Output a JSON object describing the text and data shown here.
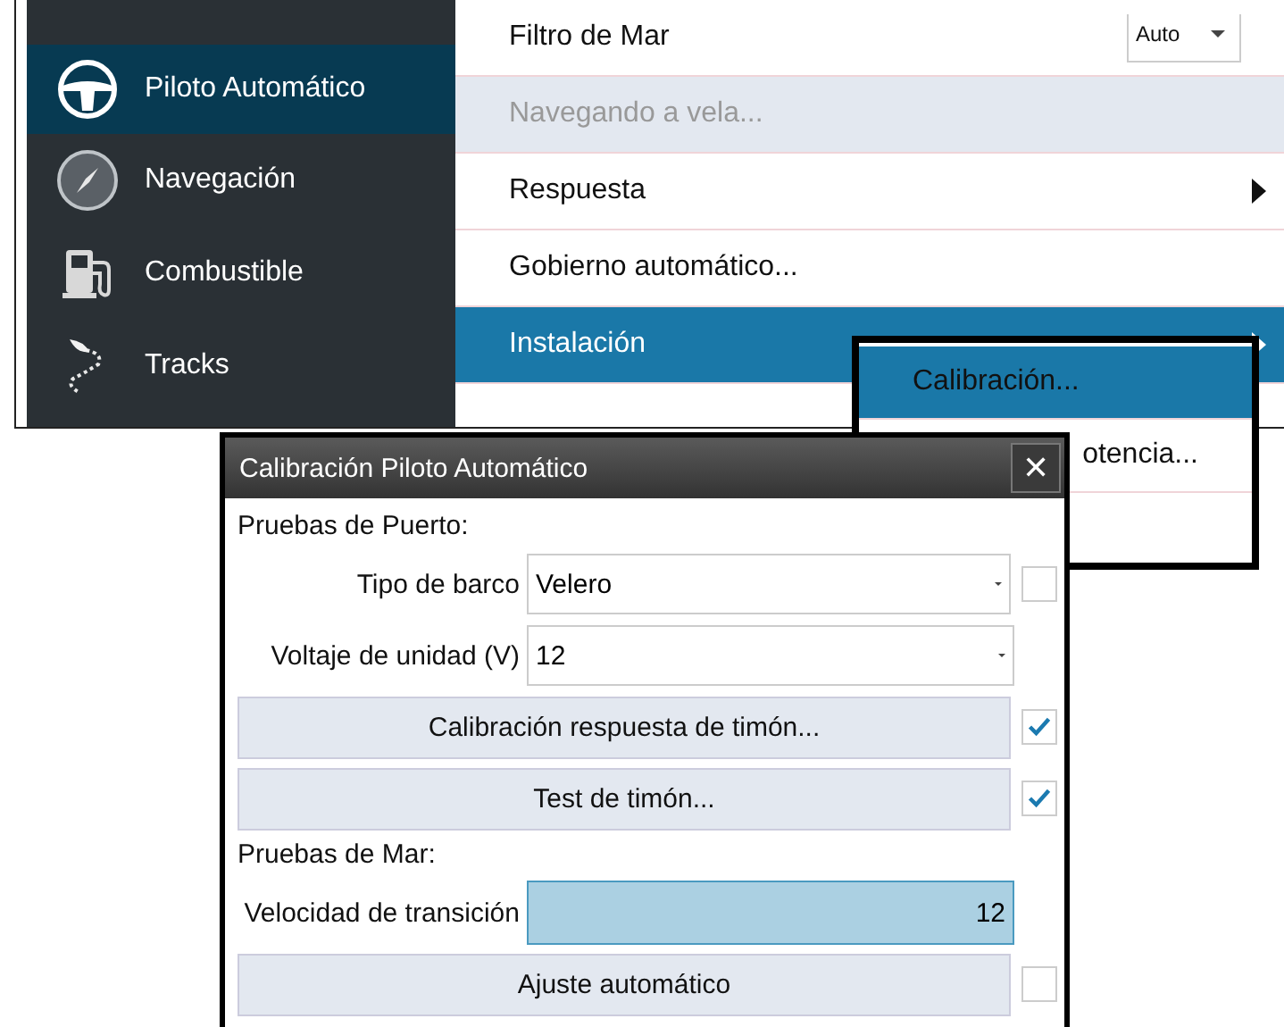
{
  "sidebar": {
    "items": [
      {
        "label": "Piloto Automático",
        "selected": true
      },
      {
        "label": "Navegación",
        "selected": false
      },
      {
        "label": "Combustible",
        "selected": false
      },
      {
        "label": "Tracks",
        "selected": false
      }
    ]
  },
  "menu": {
    "items": [
      {
        "kind": "dropdown",
        "label": "Filtro de Mar",
        "value": "Auto",
        "selected": false,
        "disabled": false
      },
      {
        "kind": "action",
        "label": "Navegando a vela...",
        "selected": false,
        "disabled": true
      },
      {
        "kind": "submenu",
        "label": "Respuesta",
        "selected": false,
        "disabled": false
      },
      {
        "kind": "action",
        "label": "Gobierno automático...",
        "selected": false,
        "disabled": false
      },
      {
        "kind": "submenu",
        "label": "Instalación",
        "selected": true,
        "disabled": false
      }
    ]
  },
  "submenu": {
    "items": [
      {
        "label": "Calibración...",
        "selected": true
      },
      {
        "label": "otencia...",
        "selected": false
      }
    ]
  },
  "dialog": {
    "title": "Calibración Piloto Automático",
    "close": "✕",
    "rows": [
      {
        "kind": "heading",
        "text": "Pruebas de Puerto:"
      },
      {
        "kind": "select",
        "label": "Tipo de barco",
        "value": "Velero",
        "checked": false
      },
      {
        "kind": "select",
        "label": "Voltaje de unidad (V)",
        "value": "12"
      },
      {
        "kind": "button",
        "label": "Calibración respuesta de timón...",
        "checked": true
      },
      {
        "kind": "button",
        "label": "Test de timón...",
        "checked": true
      },
      {
        "kind": "heading",
        "text": "Pruebas de Mar:"
      },
      {
        "kind": "field",
        "label": "Velocidad de transición",
        "value": "12"
      },
      {
        "kind": "button",
        "label": "Ajuste automático",
        "checked": false
      }
    ]
  }
}
